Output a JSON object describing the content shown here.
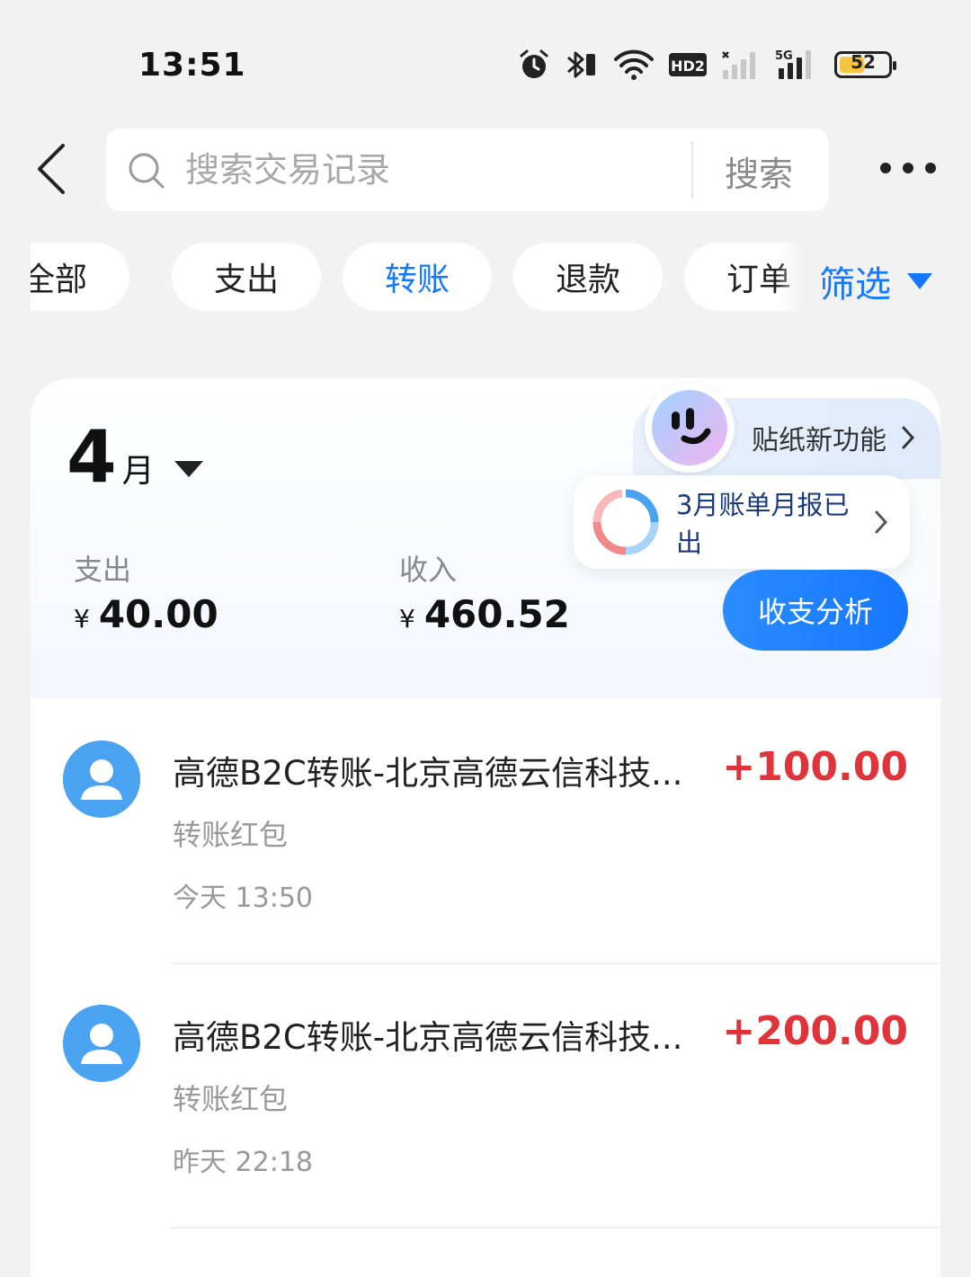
{
  "status_bar": {
    "time": "13:51",
    "icons": [
      "alarm-icon",
      "bluetooth-icon",
      "wifi-icon",
      "hd-voice-icon",
      "signal-icon",
      "5g-signal-icon"
    ],
    "hd_label": "HD2",
    "fiveg_label": "5G",
    "battery_level": "52",
    "battery_color": "#f5c542"
  },
  "header": {
    "search_placeholder": "搜索交易记录",
    "search_button": "搜索"
  },
  "filters": {
    "chips": [
      "全部",
      "支出",
      "转账",
      "退款",
      "订单"
    ],
    "active_chip": "转账",
    "filter_label": "筛选",
    "accent_color": "#1677ff"
  },
  "summary": {
    "month_number": "4",
    "month_unit": "月",
    "sticker_promo": "贴纸新功能",
    "report_text": "3月账单月报已出",
    "expense_label": "支出",
    "expense_currency": "¥",
    "expense_value": "40.00",
    "income_label": "收入",
    "income_currency": "¥",
    "income_value": "460.52",
    "analyze_button": "收支分析"
  },
  "transactions": [
    {
      "title": "高德B2C转账-北京高德云信科技...",
      "amount": "+100.00",
      "category": "转账红包",
      "time": "今天 13:50"
    },
    {
      "title": "高德B2C转账-北京高德云信科技...",
      "amount": "+200.00",
      "category": "转账红包",
      "time": "昨天 22:18"
    }
  ],
  "colors": {
    "income_amount": "#e0343a",
    "primary_blue": "#1677ff",
    "avatar_blue": "#4aa3f0"
  }
}
